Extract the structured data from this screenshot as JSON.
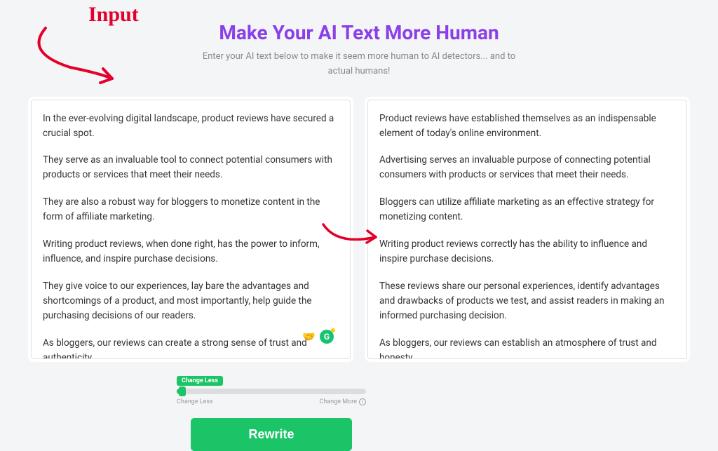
{
  "header": {
    "title": "Make Your AI Text More Human",
    "subtitle": "Enter your AI text below to make it seem more human to AI detectors... and to actual humans!"
  },
  "annotation": {
    "label": "Input"
  },
  "input_panel": {
    "paragraphs": [
      "In the ever-evolving digital landscape, product reviews have secured a crucial spot.",
      "They serve as an invaluable tool to connect potential consumers with products or services that meet their needs.",
      "They are also a robust way for bloggers to monetize content in the form of affiliate marketing.",
      "Writing product reviews, when done right, has the power to inform, influence, and inspire purchase decisions.",
      "They give voice to our experiences, lay bare the advantages and shortcomings of a product, and most importantly, help guide the purchasing decisions of our readers.",
      "As bloggers, our reviews can create a strong sense of trust and authenticity,"
    ]
  },
  "output_panel": {
    "paragraphs": [
      "Product reviews have established themselves as an indispensable element of today's online environment.",
      "Advertising serves an invaluable purpose of connecting potential consumers with products or services that meet their needs.",
      "Bloggers can utilize affiliate marketing as an effective strategy for monetizing content.",
      "Writing product reviews correctly has the ability to influence and inspire purchase decisions.",
      "These reviews share our personal experiences, identify advantages and drawbacks of products we test, and assist readers in making an informed purchasing decision.",
      "As bloggers, our reviews can establish an atmosphere of trust and honesty"
    ]
  },
  "floating": {
    "emoji": "🤝",
    "grammarly": "G"
  },
  "slider": {
    "badge": "Change Less",
    "left_caption": "Change Less",
    "right_caption": "Change More"
  },
  "buttons": {
    "rewrite": "Rewrite"
  }
}
